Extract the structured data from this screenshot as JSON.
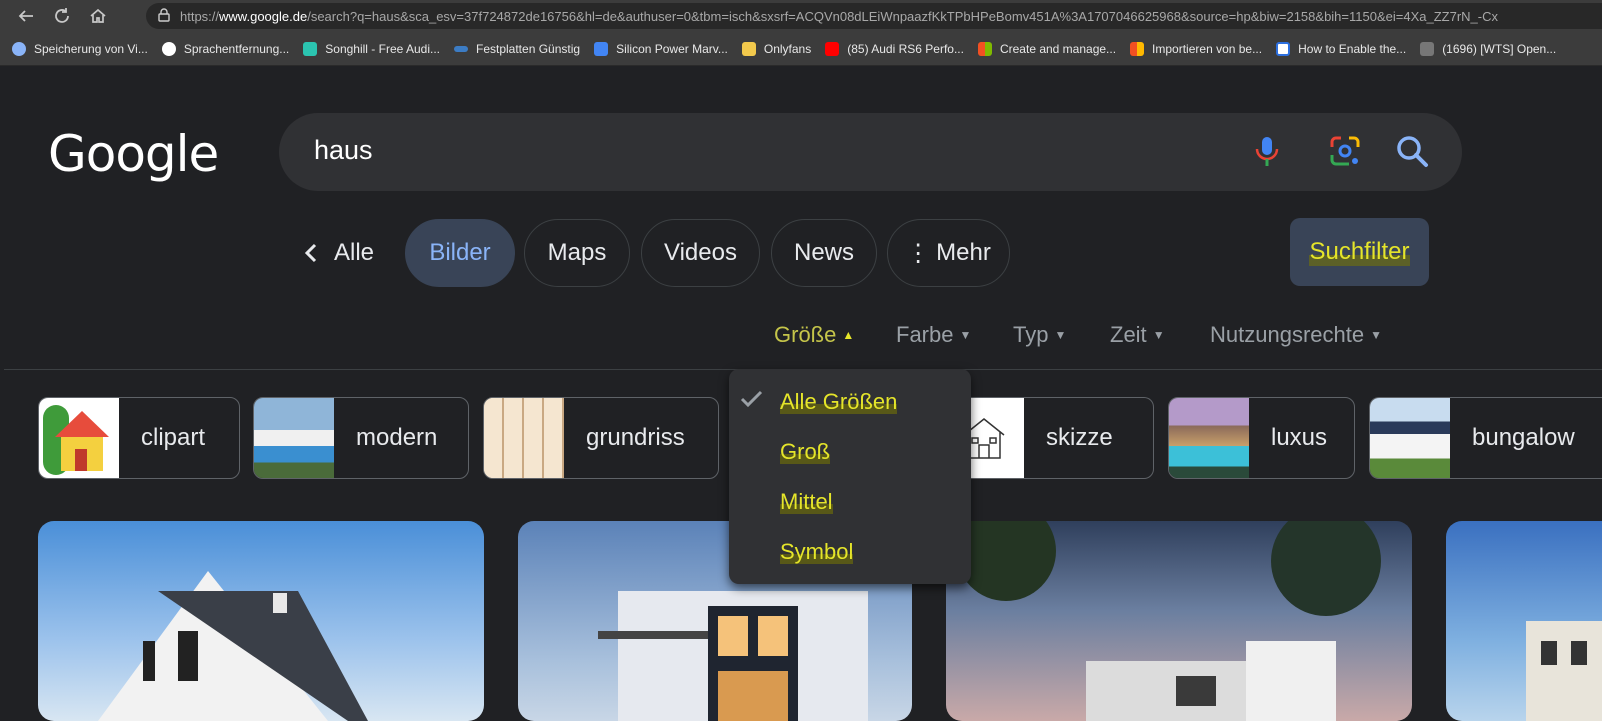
{
  "browser": {
    "url_prefix": "https://",
    "url_domain": "www.google.de",
    "url_rest": "/search?q=haus&sca_esv=37f724872de16756&hl=de&authuser=0&tbm=isch&sxsrf=ACQVn08dLEiWnpaazfKkTPbHPeBomv451A%3A1707046625968&source=hp&biw=2158&bih=1150&ei=4Xa_ZZ7rN_-Cx"
  },
  "bookmarks": [
    {
      "label": "Speicherung von Vi...",
      "color": "#8ab4f8"
    },
    {
      "label": "Sprachentfernung...",
      "color": "#ffffff"
    },
    {
      "label": "Songhill - Free Audi...",
      "color": "#2bc4b0"
    },
    {
      "label": "Festplatten Günstig",
      "color": "#3c7cc4"
    },
    {
      "label": "Silicon Power Marv...",
      "color": "#4285f4"
    },
    {
      "label": "Onlyfans",
      "color": "#f2c94c"
    },
    {
      "label": "(85) Audi RS6 Perfo...",
      "color": "#ff0000"
    },
    {
      "label": "Create and manage...",
      "color": "#f25022"
    },
    {
      "label": "Importieren von be...",
      "color": "#f25022"
    },
    {
      "label": "How to Enable the...",
      "color": "#2d6fde"
    },
    {
      "label": "(1696) [WTS] Open...",
      "color": "#777777"
    }
  ],
  "logo": "Google",
  "search": {
    "query": "haus"
  },
  "tabs": {
    "back": "Alle",
    "bilder": "Bilder",
    "maps": "Maps",
    "videos": "Videos",
    "news": "News",
    "mehr": "Mehr"
  },
  "suchfilter": "Suchfilter",
  "filters": {
    "groesse": "Größe",
    "farbe": "Farbe",
    "typ": "Typ",
    "zeit": "Zeit",
    "nutzungsrechte": "Nutzungsrechte"
  },
  "size_dropdown": {
    "items": [
      "Alle Größen",
      "Groß",
      "Mittel",
      "Symbol"
    ],
    "selected": "Alle Größen"
  },
  "chips": [
    "clipart",
    "modern",
    "grundriss",
    "skizze",
    "luxus",
    "bungalow"
  ],
  "colors": {
    "accent_blue": "#8ab4f8",
    "highlight_yellow": "#e5e52a",
    "tab_active_bg": "#394457"
  }
}
